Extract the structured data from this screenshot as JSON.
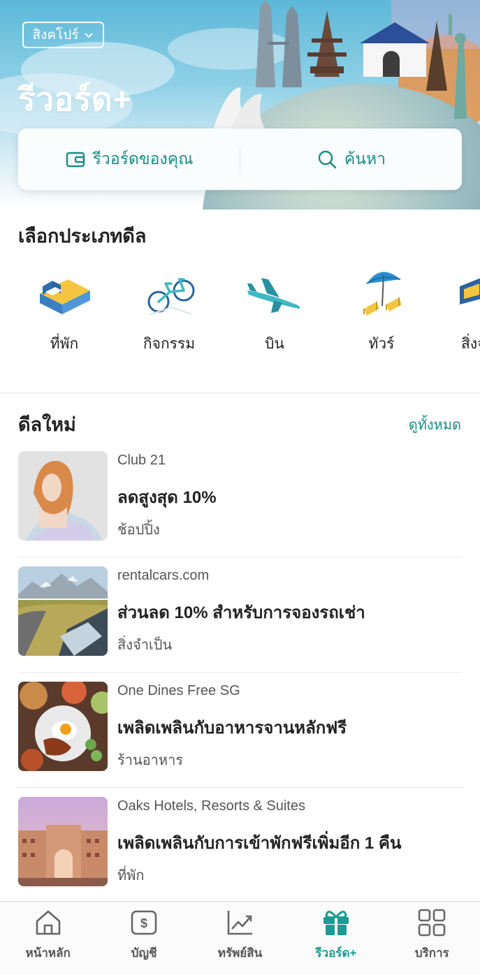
{
  "header": {
    "country": "สิงคโปร์",
    "title": "รีวอร์ด+"
  },
  "actions": {
    "my_rewards": "รีวอร์ดของคุณ",
    "search": "ค้นหา"
  },
  "deal_types": {
    "title": "เลือกประเภทดีล",
    "items": [
      {
        "label": "ที่พัก",
        "icon": "bed-icon"
      },
      {
        "label": "กิจกรรม",
        "icon": "bicycle-icon"
      },
      {
        "label": "บิน",
        "icon": "airplane-icon"
      },
      {
        "label": "ทัวร์",
        "icon": "beach-umbrella-icon"
      },
      {
        "label": "สิ่งจ",
        "icon": "essentials-icon"
      }
    ]
  },
  "new_deals": {
    "title": "ดีลใหม่",
    "see_all": "ดูทั้งหมด",
    "items": [
      {
        "merchant": "Club 21",
        "headline": "ลดสูงสุด 10%",
        "category": "ช้อปปิ้ง"
      },
      {
        "merchant": "rentalcars.com",
        "headline": "ส่วนลด 10% สำหรับการจองรถเช่า",
        "category": "สิ่งจำเป็น"
      },
      {
        "merchant": "One Dines Free SG",
        "headline": "เพลิดเพลินกับอาหารจานหลักฟรี",
        "category": "ร้านอาหาร"
      },
      {
        "merchant": "Oaks Hotels, Resorts & Suites",
        "headline": "เพลิดเพลินกับการเข้าพักฟรีเพิ่มอีก 1 คืน",
        "category": "ที่พัก"
      }
    ]
  },
  "bottom_nav": {
    "items": [
      {
        "label": "หน้าหลัก",
        "icon": "home-icon"
      },
      {
        "label": "บัญชี",
        "icon": "account-icon"
      },
      {
        "label": "ทรัพย์สิน",
        "icon": "chart-icon"
      },
      {
        "label": "รีวอร์ด+",
        "icon": "gift-icon"
      },
      {
        "label": "บริการ",
        "icon": "grid-icon"
      }
    ]
  },
  "colors": {
    "accent": "#1a8c84",
    "accent_active": "#1a9c93",
    "hero_sky": "#5cb8d8"
  }
}
